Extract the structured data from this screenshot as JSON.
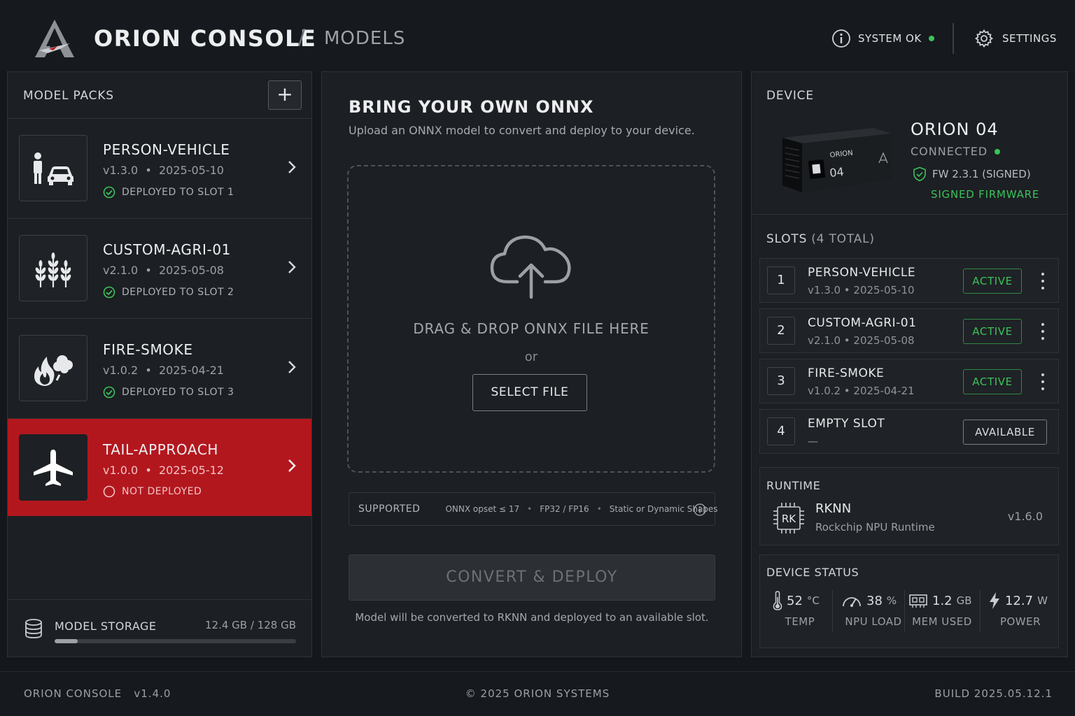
{
  "header": {
    "app_title": "ORION CONSOLE",
    "separator": "/",
    "section": "MODELS",
    "system_status": "SYSTEM OK",
    "settings_label": "SETTINGS"
  },
  "colors": {
    "accent_red": "#b3171e",
    "ok_green": "#3cc25a",
    "background": "#14171b",
    "panel": "#1c1f23"
  },
  "model_packs": {
    "title": "MODEL PACKS",
    "add_label": "+",
    "items": [
      {
        "name": "PERSON-VEHICLE",
        "version": "v1.3.0",
        "date": "2025-05-10",
        "status": "DEPLOYED TO SLOT 1",
        "icon": "person-vehicle-icon",
        "selected": false
      },
      {
        "name": "CUSTOM-AGRI-01",
        "version": "v2.1.0",
        "date": "2025-05-08",
        "status": "DEPLOYED TO SLOT 2",
        "icon": "wheat-icon",
        "selected": false
      },
      {
        "name": "FIRE-SMOKE",
        "version": "v1.0.2",
        "date": "2025-04-21",
        "status": "DEPLOYED TO SLOT 3",
        "icon": "fire-smoke-icon",
        "selected": false
      },
      {
        "name": "TAIL-APPROACH",
        "version": "v1.0.0",
        "date": "2025-05-12",
        "status": "NOT DEPLOYED",
        "icon": "airplane-icon",
        "selected": true
      }
    ],
    "storage": {
      "label": "MODEL STORAGE",
      "value": "12.4 GB / 128 GB",
      "used_fraction": 0.097
    }
  },
  "upload": {
    "title": "BRING YOUR OWN ONNX",
    "subtitle": "Upload an ONNX model to convert and deploy to your device.",
    "drop_text": "DRAG & DROP ONNX FILE HERE",
    "or_text": "or",
    "select_label": "SELECT FILE",
    "supported_label": "SUPPORTED",
    "supported_items": [
      "ONNX opset ≤ 17",
      "FP32 / FP16",
      "Static or Dynamic Shapes"
    ],
    "dot": "•",
    "convert_label": "CONVERT & DEPLOY",
    "convert_note": "Model will be converted to RKNN and deployed to an available slot."
  },
  "device": {
    "title": "DEVICE",
    "name": "ORION 04",
    "connection": "CONNECTED",
    "firmware": "FW 2.3.1 (SIGNED)",
    "firmware_note": "SIGNED FIRMWARE",
    "image_label_brand": "ORION",
    "image_label_num": "04"
  },
  "slots": {
    "title": "SLOTS",
    "total": "(4 TOTAL)",
    "items": [
      {
        "num": "1",
        "name": "PERSON-VEHICLE",
        "meta": "v1.3.0  •  2025-05-10",
        "badge": "ACTIVE"
      },
      {
        "num": "2",
        "name": "CUSTOM-AGRI-01",
        "meta": "v2.1.0  •  2025-05-08",
        "badge": "ACTIVE"
      },
      {
        "num": "3",
        "name": "FIRE-SMOKE",
        "meta": "v1.0.2  •  2025-04-21",
        "badge": "ACTIVE"
      },
      {
        "num": "4",
        "name": "EMPTY SLOT",
        "meta": "—",
        "badge": "AVAILABLE"
      }
    ]
  },
  "runtime": {
    "title": "RUNTIME",
    "chip_label": "RK",
    "name": "RKNN",
    "description": "Rockchip NPU Runtime",
    "version": "v1.6.0"
  },
  "device_status": {
    "title": "DEVICE STATUS",
    "temp": {
      "value": "52",
      "unit": "°C",
      "label": "TEMP"
    },
    "npu": {
      "value": "38",
      "unit": "%",
      "label": "NPU LOAD"
    },
    "mem": {
      "value": "1.2",
      "unit": "GB",
      "label": "MEM USED"
    },
    "power": {
      "value": "12.7",
      "unit": "W",
      "label": "POWER"
    }
  },
  "footer": {
    "left": "ORION CONSOLE   v1.4.0",
    "center": "© 2025 ORION SYSTEMS",
    "right": "BUILD 2025.05.12.1"
  }
}
